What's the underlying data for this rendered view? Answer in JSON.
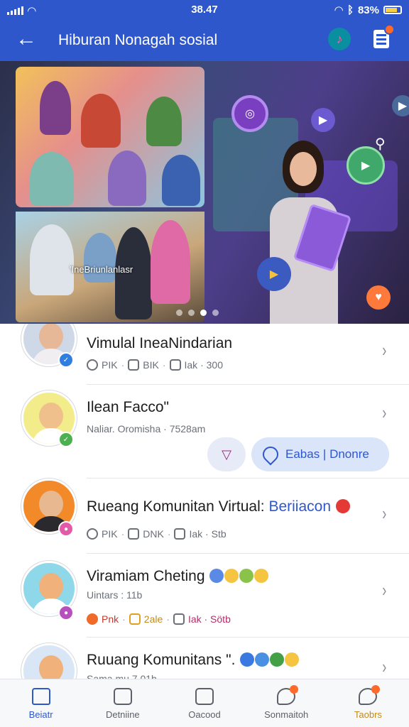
{
  "status_bar": {
    "time": "38.47",
    "battery": "83%"
  },
  "app_bar": {
    "title": "Hiburan Nonagah sosial"
  },
  "hero": {
    "overlay_label": "'IneBriunlanlasr",
    "page_dots": 4,
    "active_dot": 2
  },
  "list": [
    {
      "name": "Vimulal IneaNindarian",
      "meta": [
        "PIK",
        "BIK",
        "Iak · 300"
      ]
    },
    {
      "name": "Ilean Facco\"",
      "subtitle": "Naliar. Oromisha · 7528am",
      "actions": {
        "primary_label": "Eabas | Dnonre"
      }
    },
    {
      "name": "Rueang Komunitan Virtual:",
      "name_highlight": "Beriiacon",
      "meta": [
        "PIK",
        "DNK",
        "Iak · Stb"
      ]
    },
    {
      "name": "Viramiam Cheting",
      "subtitle": "Uintars : 11b",
      "meta": [
        "Pnk",
        "2ale",
        "Iak · Sötb"
      ]
    },
    {
      "name": "Ruuang Komunitans \".",
      "subtitle": "Sama mu 7 01b"
    }
  ],
  "tabs": [
    {
      "label": "Beiatr",
      "icon": "home-icon",
      "active": true
    },
    {
      "label": "Detniine",
      "icon": "camera-icon"
    },
    {
      "label": "Oacood",
      "icon": "media-icon"
    },
    {
      "label": "Sonmaitoh",
      "icon": "chat-icon",
      "badge": true
    },
    {
      "label": "Taobrs",
      "icon": "inbox-icon",
      "badge": true
    }
  ],
  "colors": {
    "brand": "#2f57cc",
    "badge": "#ff6a2a"
  }
}
